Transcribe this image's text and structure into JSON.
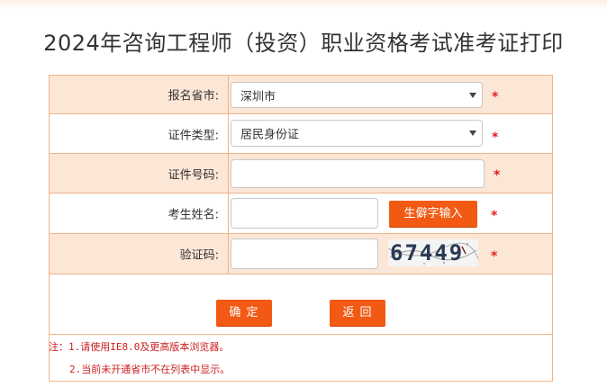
{
  "page": {
    "title": "2024年咨询工程师（投资）职业资格考试准考证打印"
  },
  "form": {
    "province": {
      "label": "报名省市:",
      "value": "深圳市"
    },
    "id_type": {
      "label": "证件类型:",
      "value": "居民身份证"
    },
    "id_number": {
      "label": "证件号码:",
      "value": "",
      "placeholder": ""
    },
    "name": {
      "label": "考生姓名:",
      "value": "",
      "rare_char_button": "生僻字输入"
    },
    "captcha": {
      "label": "验证码:",
      "value": "",
      "image_text": "67449"
    },
    "required_mark": "*"
  },
  "buttons": {
    "confirm": "确 定",
    "back": "返 回"
  },
  "notes": [
    "注：1.请使用IE8.0及更高版本浏览器。",
    "2.当前未开通省市不在列表中显示。"
  ],
  "colors": {
    "accent": "#f25a14",
    "row_tint": "#fce6d6",
    "border": "#f0b489",
    "required": "#e02020",
    "note_text": "#cc1f1f"
  }
}
